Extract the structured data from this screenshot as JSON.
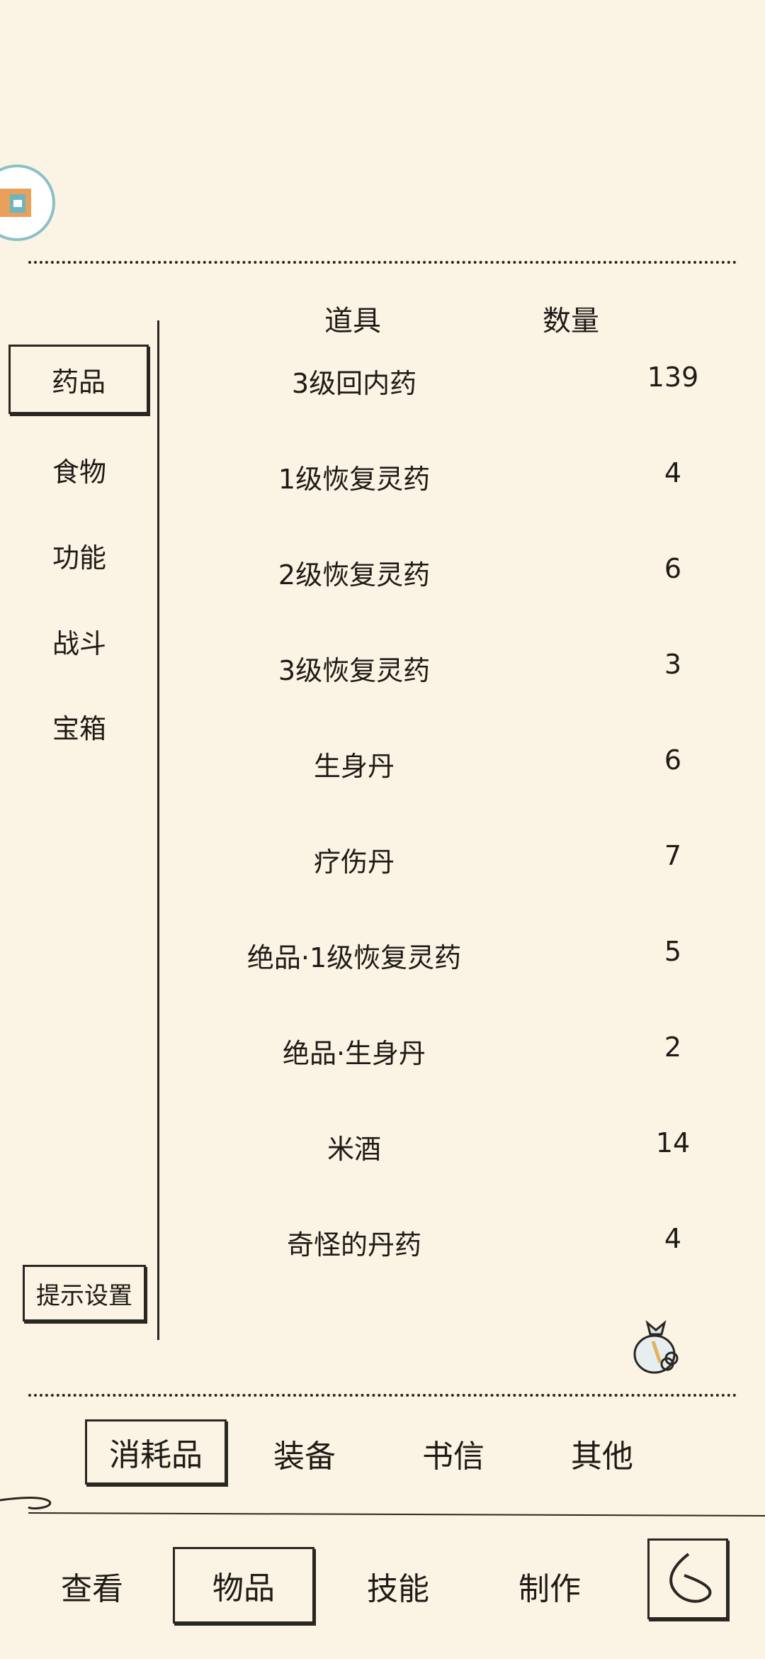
{
  "header": {
    "columns": {
      "item": "道具",
      "quantity": "数量"
    }
  },
  "categories": [
    {
      "label": "药品",
      "selected": true
    },
    {
      "label": "食物",
      "selected": false
    },
    {
      "label": "功能",
      "selected": false
    },
    {
      "label": "战斗",
      "selected": false
    },
    {
      "label": "宝箱",
      "selected": false
    }
  ],
  "hint_settings_label": "提示设置",
  "items": [
    {
      "name": "3级回内药",
      "qty": "139"
    },
    {
      "name": "1级恢复灵药",
      "qty": "4"
    },
    {
      "name": "2级恢复灵药",
      "qty": "6"
    },
    {
      "name": "3级恢复灵药",
      "qty": "3"
    },
    {
      "name": "生身丹",
      "qty": "6"
    },
    {
      "name": "疗伤丹",
      "qty": "7"
    },
    {
      "name": "绝品·1级恢复灵药",
      "qty": "5"
    },
    {
      "name": "绝品·生身丹",
      "qty": "2"
    },
    {
      "name": "米酒",
      "qty": "14"
    },
    {
      "name": "奇怪的丹药",
      "qty": "4"
    }
  ],
  "sub_tabs": [
    {
      "label": "消耗品",
      "selected": true
    },
    {
      "label": "装备",
      "selected": false
    },
    {
      "label": "书信",
      "selected": false
    },
    {
      "label": "其他",
      "selected": false
    }
  ],
  "bottom_nav": [
    {
      "label": "查看",
      "selected": false
    },
    {
      "label": "物品",
      "selected": true
    },
    {
      "label": "技能",
      "selected": false
    },
    {
      "label": "制作",
      "selected": false
    }
  ],
  "icons": {
    "avatar": "avatar-badge-icon",
    "bag": "bag-icon",
    "back": "back-icon"
  },
  "colors": {
    "background": "#fbf4e4",
    "ink": "#2a2622"
  }
}
